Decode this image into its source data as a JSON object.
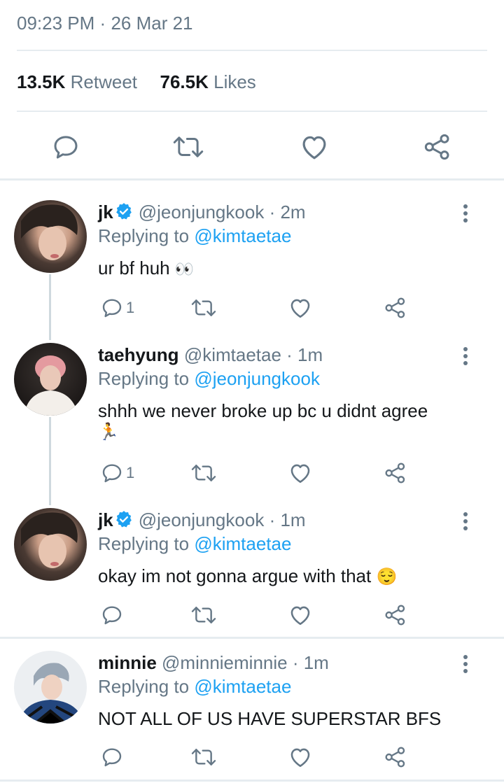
{
  "header": {
    "time": "09:23 PM",
    "separator": "·",
    "date": "26 Mar 21"
  },
  "stats": {
    "retweets_count": "13.5K",
    "retweets_label": "Retweet",
    "likes_count": "76.5K",
    "likes_label": "Likes"
  },
  "replies": [
    {
      "name": "jk",
      "verified": true,
      "handle": "@jeonjungkook",
      "age": "· 2m",
      "replying_prefix": "Replying to",
      "replying_to": "@kimtaetae",
      "text": "ur bf huh",
      "emoji": "👀",
      "reply_count": "1"
    },
    {
      "name": "taehyung",
      "verified": false,
      "handle": "@kimtaetae",
      "age": "· 1m",
      "replying_prefix": "Replying to",
      "replying_to": "@jeonjungkook",
      "text": "shhh we never broke up bc u didnt agree",
      "emoji": "🏃",
      "reply_count": "1"
    },
    {
      "name": "jk",
      "verified": true,
      "handle": "@jeonjungkook",
      "age": "· 1m",
      "replying_prefix": "Replying to",
      "replying_to": "@kimtaetae",
      "text": "okay im not gonna argue with that",
      "emoji": "😌",
      "reply_count": ""
    },
    {
      "name": "minnie",
      "verified": false,
      "handle": "@minnieminnie",
      "age": "· 1m",
      "replying_prefix": "Replying to",
      "replying_to": "@kimtaetae",
      "text": "NOT ALL OF US HAVE SUPERSTAR BFS",
      "emoji": "",
      "reply_count": ""
    }
  ],
  "icons": {
    "reply": "reply-icon",
    "retweet": "retweet-icon",
    "like": "heart-icon",
    "share": "share-icon",
    "more": "more-vertical-icon",
    "verified": "verified-badge-icon"
  },
  "colors": {
    "accent": "#1da1f2",
    "muted": "#657786",
    "divider": "#e6ecf0"
  }
}
